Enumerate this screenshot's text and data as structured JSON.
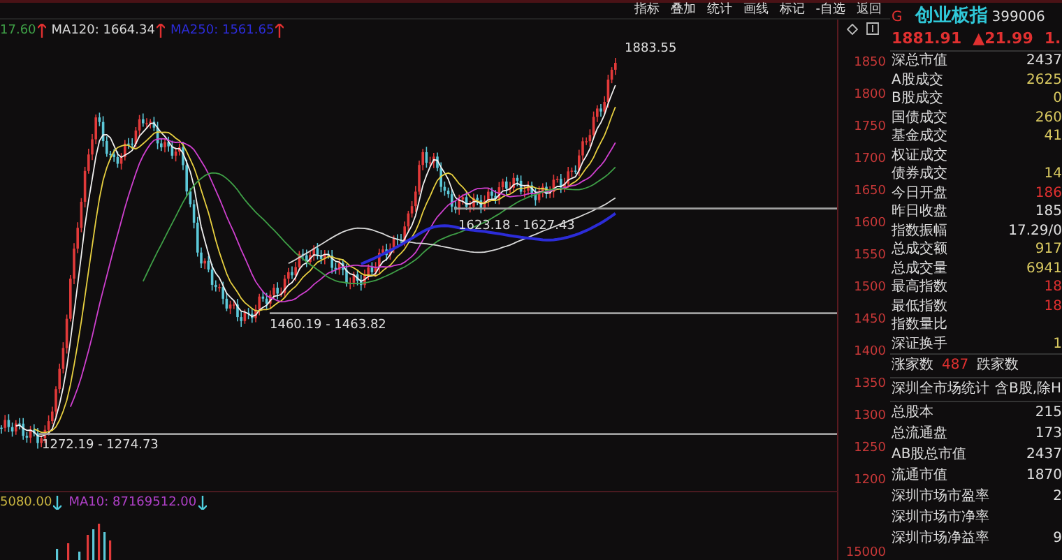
{
  "toolbar": [
    "指标",
    "叠加",
    "统计",
    "画线",
    "标记",
    "-自选",
    "返回"
  ],
  "legend": [
    {
      "text": "17.60",
      "color": "#3fa047",
      "rising": true
    },
    {
      "text": "MA120: 1664.34",
      "color": "#d8d8d8",
      "rising": true
    },
    {
      "text": "MA250: 1561.65",
      "color": "#2c2cd8",
      "rising": true
    }
  ],
  "annotations": [
    "1883.55",
    "1623.18 - 1627.43",
    "1460.19 - 1463.82",
    "1272.19 - 1274.73"
  ],
  "price_axis": [
    "1850",
    "1800",
    "1750",
    "1700",
    "1650",
    "1600",
    "1550",
    "1500",
    "1450",
    "1400",
    "1350",
    "1300",
    "1250",
    "1200"
  ],
  "volume_axis": [
    "15000"
  ],
  "volume_legend": [
    {
      "text": "5080.00",
      "color": "#c8b440",
      "rising": false
    },
    {
      "text": "MA10: 87169512.00",
      "color": "#b040c8",
      "rising": false
    }
  ],
  "quote": {
    "marker": "G",
    "name": "创业板指",
    "code": "399006",
    "price": "1881.91",
    "change": "▲21.99",
    "change_pct": "1."
  },
  "stats": [
    {
      "label": "深总市值",
      "value": "2437",
      "color": "#e0e0e0"
    },
    {
      "label": "A股成交",
      "value": "2625",
      "color": "#d8c860"
    },
    {
      "label": "B股成交",
      "value": "0",
      "color": "#d8c860"
    },
    {
      "label": "国债成交",
      "value": "260",
      "color": "#d8c860"
    },
    {
      "label": "基金成交",
      "value": "41",
      "color": "#d8c860"
    },
    {
      "label": "权证成交"
    },
    {
      "label": "债券成交",
      "value": "14",
      "color": "#d8c860"
    },
    {
      "label": "今日开盘",
      "value": "186",
      "color": "#e03030"
    },
    {
      "label": "昨日收盘",
      "value": "185",
      "color": "#e0e0e0"
    },
    {
      "label": "指数振幅",
      "value": "17.29/0",
      "color": "#e0e0e0"
    },
    {
      "label": "总成交额",
      "value": "917",
      "color": "#d8c860"
    },
    {
      "label": "总成交量",
      "value": "6941",
      "color": "#d8c860"
    },
    {
      "label": "最高指数",
      "value": "18",
      "color": "#e03030"
    },
    {
      "label": "最低指数",
      "value": "18",
      "color": "#e03030"
    },
    {
      "label": "指数量比"
    },
    {
      "label": "深证换手",
      "value": "1",
      "color": "#d8c860"
    }
  ],
  "breadth": {
    "up_label": "涨家数",
    "up_count": "487",
    "down_label": "跌家数"
  },
  "market": {
    "title": "深圳全市场统计",
    "note": "含B股,除H",
    "rows": [
      {
        "label": "总股本",
        "value": "215"
      },
      {
        "label": "总流通盘",
        "value": "173"
      },
      {
        "label": "AB股总市值",
        "value": "2437"
      },
      {
        "label": "流通市值",
        "value": "1870"
      },
      {
        "label": "深圳市场市盈率",
        "value": "2"
      },
      {
        "label": "深圳市场市净率"
      },
      {
        "label": "深圳市场净益率",
        "value": "9"
      }
    ]
  }
}
